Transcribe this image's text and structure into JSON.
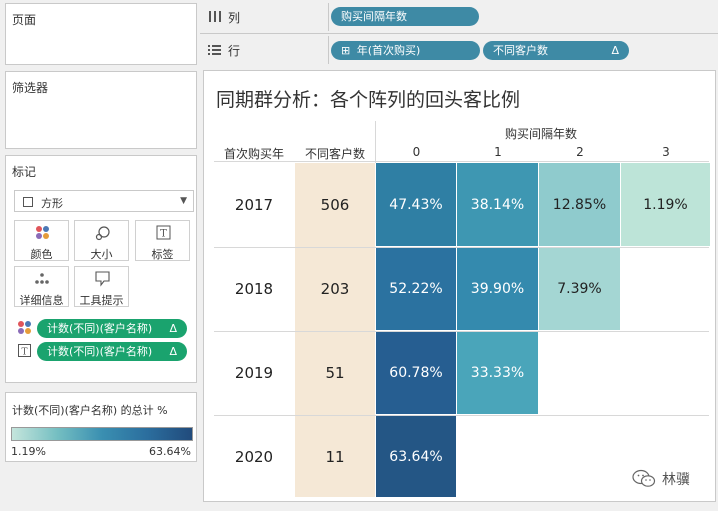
{
  "left": {
    "pages_title": "页面",
    "filters_title": "筛选器",
    "marks_title": "标记",
    "mark_type": "方形",
    "buttons": {
      "color": "颜色",
      "size": "大小",
      "label": "标签",
      "detail": "详细信息",
      "tooltip": "工具提示"
    },
    "mark_pills": [
      {
        "label": "计数(不同)(客户名称)",
        "delta": "Δ",
        "kind": "color"
      },
      {
        "label": "计数(不同)(客户名称)",
        "delta": "Δ",
        "kind": "label"
      }
    ],
    "legend": {
      "title": "计数(不同)(客户名称) 的总计 %",
      "min": "1.19%",
      "max": "63.64%",
      "color_min": "#c5e5dc",
      "color_max": "#214b7c"
    }
  },
  "shelves": {
    "columns_label": "列",
    "rows_label": "行",
    "columns_pills": [
      "购买间隔年数"
    ],
    "rows_pills": [
      {
        "label": "年(首次购买)",
        "prefix": "⊞"
      },
      {
        "label": "不同客户数",
        "delta": "Δ"
      }
    ]
  },
  "viz": {
    "title": "同期群分析：各个阵列的回头客比例",
    "header_col_group": "购买间隔年数",
    "row_header_1": "首次购买年",
    "row_header_2": "不同客户数",
    "columns": [
      "0",
      "1",
      "2",
      "3"
    ],
    "rows": [
      {
        "year": "2017",
        "customers": "506",
        "values": [
          "47.43%",
          "38.14%",
          "12.85%",
          "1.19%"
        ]
      },
      {
        "year": "2018",
        "customers": "203",
        "values": [
          "52.22%",
          "39.90%",
          "7.39%",
          ""
        ]
      },
      {
        "year": "2019",
        "customers": "51",
        "values": [
          "60.78%",
          "33.33%",
          "",
          ""
        ]
      },
      {
        "year": "2020",
        "customers": "11",
        "values": [
          "63.64%",
          "",
          "",
          ""
        ]
      }
    ],
    "cell_colors": [
      [
        "#2f7fa4",
        "#3e97b2",
        "#8fcbcd",
        "#bde4d8"
      ],
      [
        "#2b72a0",
        "#348aae",
        "#a4d6d3",
        ""
      ],
      [
        "#265e91",
        "#4aa5ba",
        "",
        ""
      ],
      [
        "#245685",
        "",
        "",
        ""
      ]
    ],
    "customers_col_color": "#f5e8d6"
  },
  "watermark": "林骥"
}
